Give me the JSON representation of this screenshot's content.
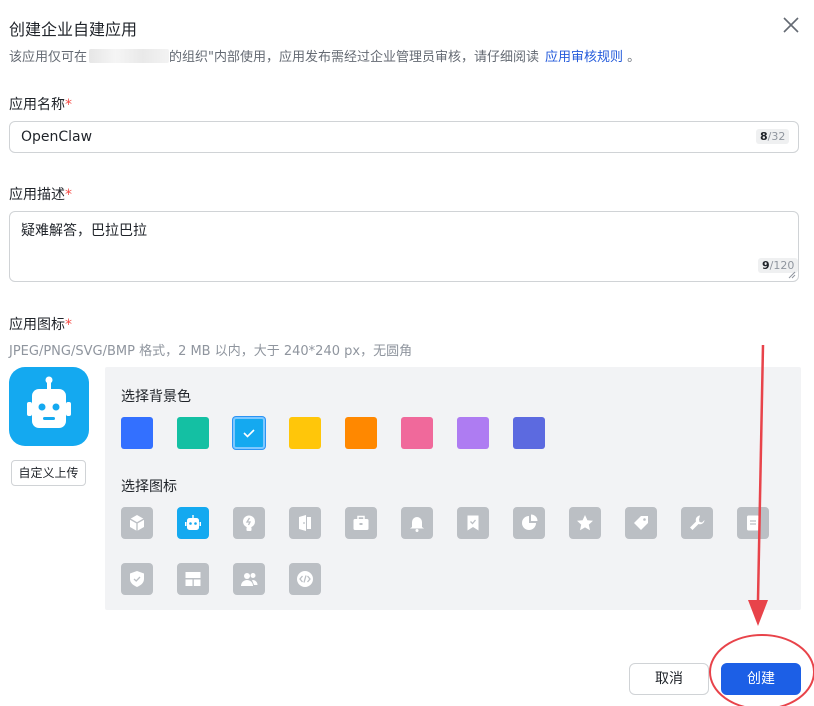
{
  "dialog": {
    "title": "创建企业自建应用",
    "subtitle_prefix": "该应用仅可在",
    "subtitle_suffix": "的组织\"内部使用，应用发布需经过企业管理员审核，请仔细阅读",
    "subtitle_link": "应用审核规则",
    "subtitle_end": "。"
  },
  "name_field": {
    "label": "应用名称",
    "required_mark": "*",
    "value": "OpenClaw",
    "count": "8",
    "max": "/32"
  },
  "desc_field": {
    "label": "应用描述",
    "required_mark": "*",
    "value": "疑难解答，巴拉巴拉",
    "count": "9",
    "max": "/120"
  },
  "icon_field": {
    "label": "应用图标",
    "required_mark": "*",
    "hint": "JPEG/PNG/SVG/BMP 格式，2 MB 以内，大于 240*240 px，无圆角",
    "upload_label": "自定义上传",
    "bg_label": "选择背景色",
    "icon_label": "选择图标",
    "bg_colors": [
      "#3370ff",
      "#14c0a3",
      "#14a9f0",
      "#ffc60a",
      "#ff8800",
      "#f0699b",
      "#ae7cf2",
      "#5c6ae0"
    ],
    "selected_color": "#14a9f0",
    "icons": [
      "box-icon",
      "robot-icon",
      "lightbulb-icon",
      "door-icon",
      "briefcase-icon",
      "bell-icon",
      "bookmark-icon",
      "pie-chart-icon",
      "star-icon",
      "tag-icon",
      "wrench-icon",
      "document-icon",
      "shield-icon",
      "layout-icon",
      "users-icon",
      "code-icon"
    ],
    "selected_icon": "robot-icon"
  },
  "footer": {
    "cancel_label": "取消",
    "create_label": "创建"
  }
}
